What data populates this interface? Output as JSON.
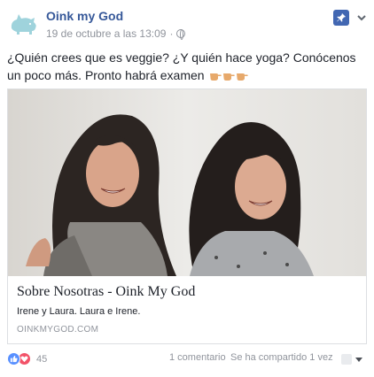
{
  "post": {
    "page_name": "Oink my God",
    "timestamp": "19 de octubre a las 13:09",
    "separator": "·",
    "privacy_icon": "globe-icon",
    "message": "¿Quién crees que es veggie? ¿Y quién hace yoga? Conócenos un poco más. Pronto habrá examen",
    "message_emojis": [
      "pointing-hand-emoji",
      "pointing-hand-emoji",
      "pointing-hand-emoji"
    ]
  },
  "link_card": {
    "title": "Sobre Nosotras - Oink My God",
    "description": "Irene y Laura. Laura e Irene.",
    "domain": "OINKMYGOD.COM"
  },
  "footer": {
    "reaction_count": "45",
    "comments": "1 comentario",
    "shares": "Se ha compartido 1 vez"
  },
  "colors": {
    "link_blue": "#365899",
    "meta_gray": "#90949c",
    "pin_blue": "#4267b2",
    "like_blue": "#5890ff",
    "love_red": "#f25268",
    "border": "#dddfe2"
  }
}
